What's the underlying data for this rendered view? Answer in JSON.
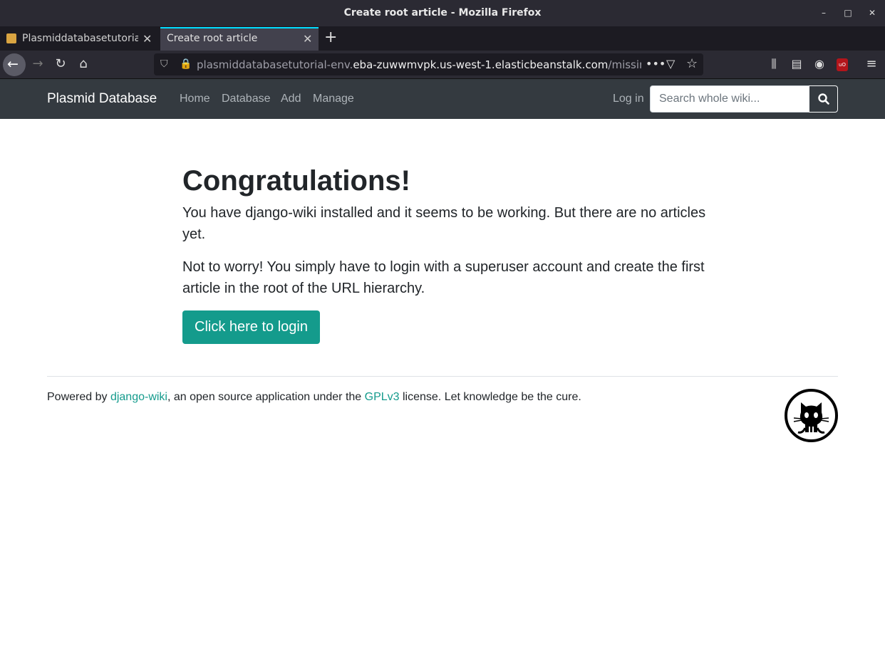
{
  "window": {
    "title": "Create root article - Mozilla Firefox"
  },
  "tabs": [
    {
      "label": "Plasmiddatabasetutorial"
    },
    {
      "label": "Create root article"
    }
  ],
  "url": {
    "prefix": "plasmiddatabasetutorial-env.",
    "host": "eba-zuwwmvpk.us-west-1.elasticbeanstalk.com",
    "path": "/missing-root"
  },
  "site_nav": {
    "brand": "Plasmid Database",
    "links": [
      "Home",
      "Database",
      "Add",
      "Manage"
    ],
    "login": "Log in",
    "search_placeholder": "Search whole wiki..."
  },
  "main": {
    "heading": "Congratulations!",
    "paragraph1": "You have django-wiki installed and it seems to be working. But there are no articles yet.",
    "paragraph2": "Not to worry! You simply have to login with a superuser account and create the first article in the root of the URL hierarchy.",
    "button": "Click here to login"
  },
  "footer": {
    "text_before": "Powered by ",
    "link1": "django-wiki",
    "text_middle": ", an open source application under the ",
    "link2": "GPLv3",
    "text_after": " license. Let knowledge be the cure."
  },
  "colors": {
    "accent": "#149b8c",
    "navbar": "#343a40"
  }
}
